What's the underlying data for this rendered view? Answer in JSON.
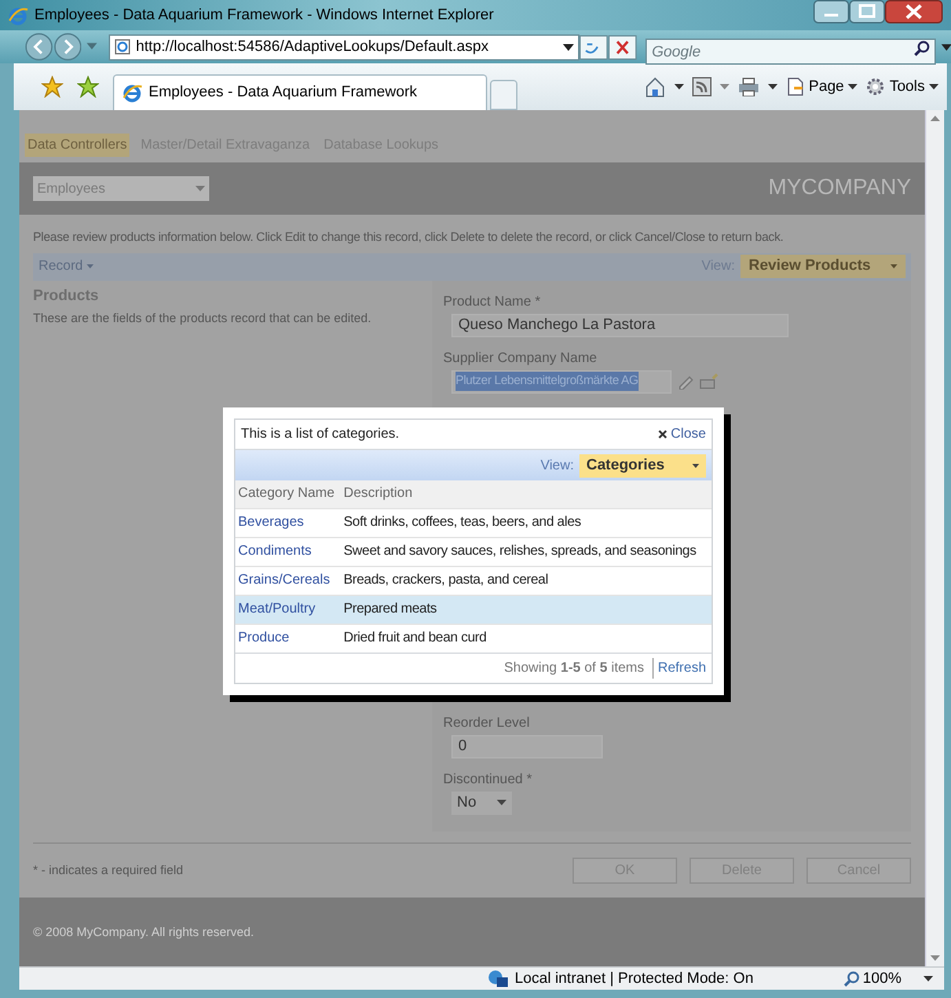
{
  "window": {
    "title": "Employees - Data Aquarium Framework - Windows Internet Explorer"
  },
  "address_bar": {
    "url": "http://localhost:54586/AdaptiveLookups/Default.aspx",
    "search_placeholder": "Google"
  },
  "browser_tab": {
    "title": "Employees - Data Aquarium Framework"
  },
  "command_bar": [
    "Page",
    "Tools"
  ],
  "page": {
    "nav_tabs": [
      {
        "label": "Data Controllers",
        "selected": true
      },
      {
        "label": "Master/Detail Extravaganza",
        "selected": false
      },
      {
        "label": "Database Lookups",
        "selected": false
      }
    ],
    "controller_select": "Employees",
    "brand": "MYCOMPANY",
    "instructions": "Please review products information below. Click Edit to change this record, click Delete to delete the record, or click Cancel/Close to return back.",
    "action_bar": {
      "menu": "Record",
      "view_label": "View:",
      "view": "Review Products"
    },
    "section": {
      "title": "Products",
      "description": "These are the fields of the products record that can be edited."
    },
    "fields_top": [
      {
        "kind": "text",
        "label": "Product Name *",
        "value": "Queso Manchego La Pastora"
      },
      {
        "kind": "lookup",
        "label": "Supplier Company Name",
        "value": "Plutzer Lebensmittelgroßmärkte AG"
      }
    ],
    "fields_bottom": [
      {
        "kind": "text",
        "label": "Reorder Level",
        "value": "0"
      },
      {
        "kind": "select",
        "label": "Discontinued *",
        "value": "No"
      }
    ],
    "required_note": "* - indicates a required field",
    "buttons": [
      "OK",
      "Delete",
      "Cancel"
    ],
    "footer": "© 2008 MyCompany. All rights reserved."
  },
  "dialog": {
    "message": "This is a list of categories.",
    "close": "Close",
    "view_label": "View:",
    "view": "Categories",
    "columns": [
      "Category Name",
      "Description"
    ],
    "rows": [
      {
        "name": "Beverages",
        "description": "Soft drinks, coffees, teas, beers, and ales",
        "selected": false
      },
      {
        "name": "Condiments",
        "description": "Sweet and savory sauces, relishes, spreads, and seasonings",
        "selected": false
      },
      {
        "name": "Grains/Cereals",
        "description": "Breads, crackers, pasta, and cereal",
        "selected": false
      },
      {
        "name": "Meat/Poultry",
        "description": "Prepared meats",
        "selected": true
      },
      {
        "name": "Produce",
        "description": "Dried fruit and bean curd",
        "selected": false
      }
    ],
    "pager": "Showing **1-5** of **5** items",
    "refresh": "Refresh"
  },
  "status_bar": {
    "zone": "Local intranet | Protected Mode: On",
    "zoom": "100%"
  }
}
